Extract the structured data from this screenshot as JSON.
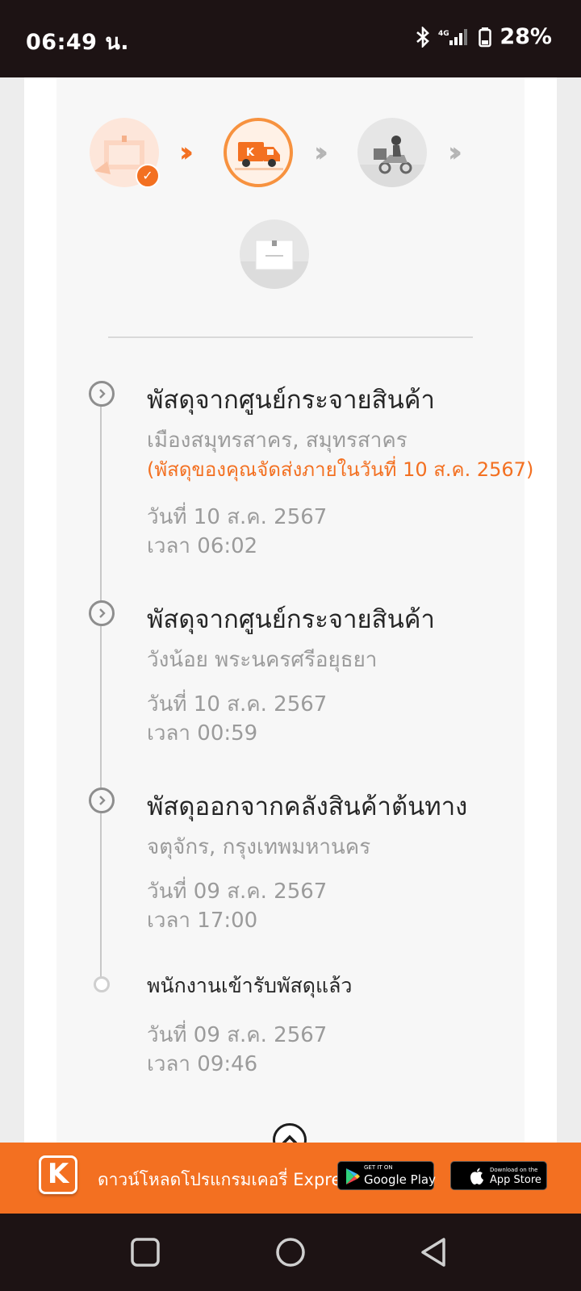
{
  "status_bar": {
    "time": "06:49 น.",
    "battery": "28%",
    "network": "4G"
  },
  "progress": {
    "steps": [
      {
        "name": "picked-up",
        "state": "done"
      },
      {
        "name": "in-transit",
        "state": "active"
      },
      {
        "name": "out-for-delivery",
        "state": "pending"
      },
      {
        "name": "delivered",
        "state": "pending"
      }
    ],
    "accent_color": "#f37021"
  },
  "timeline": [
    {
      "title": "พัสดุจากศูนย์กระจายสินค้า",
      "location": "เมืองสมุทรสาคร, สมุทรสาคร",
      "note": "(พัสดุของคุณจัดส่งภายในวันที่ 10 ส.ค. 2567)",
      "date": "วันที่ 10 ส.ค. 2567",
      "time": "เวลา 06:02"
    },
    {
      "title": "พัสดุจากศูนย์กระจายสินค้า",
      "location": "วังน้อย พระนครศรีอยุธยา",
      "date": "วันที่ 10 ส.ค. 2567",
      "time": "เวลา 00:59"
    },
    {
      "title": "พัสดุออกจากคลังสินค้าต้นทาง",
      "location": "จตุจักร, กรุงเทพมหานคร",
      "date": "วันที่ 09 ส.ค. 2567",
      "time": "เวลา 17:00"
    },
    {
      "title": "พนักงานเข้ารับพัสดุแล้ว",
      "date": "วันที่ 09 ส.ค. 2567",
      "time": "เวลา 09:46"
    }
  ],
  "banner": {
    "text": "ดาวน์โหลดโปรแกรมเคอรี่ Express",
    "logo_letter": "K",
    "google_play": {
      "small": "GET IT ON",
      "big": "Google Play"
    },
    "app_store": {
      "small": "Download on the",
      "big": "App Store"
    }
  }
}
